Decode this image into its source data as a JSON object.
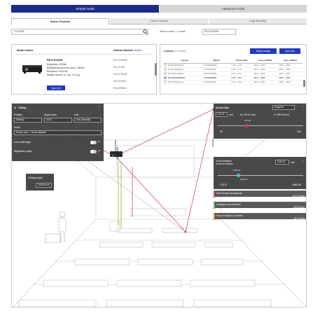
{
  "mode_tabs": {
    "simple": "Simple mode",
    "advanced": "Advanced mode"
  },
  "sub_tabs": {
    "search": "Search Projector",
    "current": "Current website",
    "edge": "Edge Blending"
  },
  "search": {
    "value": "PJ2330B",
    "result_label": "Search result : 1 model",
    "result_value": "EB-PJ2330B"
  },
  "model_panel": {
    "header": "Model Name",
    "similar_label": "Similar Models",
    "similar_select": "Select",
    "model": "EB-PJ2330B",
    "specs": [
      "Brightness: 3300lm",
      "Brightness(reduced by lens): 3300lm",
      "Resolution: WUXGA",
      "Weight: Approx. 8.7 kg / 19.2 kg"
    ],
    "spec_button": "Spec info",
    "similar_models": [
      "Pro-G7000W",
      "Pro-G7100",
      "Pro-G7200W",
      "Pro-G7400U",
      "Pro-G7500U"
    ]
  },
  "lens_panel": {
    "title": "Lenses",
    "count": "(5 model)",
    "change_button": "Media change",
    "spec_button": "Spec info",
    "columns": [
      "Lenses",
      "Model",
      "Throw ratio",
      "Lens shift(V)",
      "Lens shift(H)"
    ],
    "rows": [
      [
        "ELPLW05(Wide)",
        "V12H004W05",
        "1.04 - 1.26",
        "-60% ~ 60%",
        "-18% ~ 18%"
      ],
      [
        "ELPLU03(Wide)",
        "V12H004U03",
        "0.65 - 0.78",
        "-60% ~ 60%",
        "-18% ~ 18%"
      ],
      [
        "ELPLW04(Wide)",
        "V12H004W04",
        "1.01 - 1.51",
        "-60% ~ 60%",
        "-18% ~ 18%"
      ],
      [
        "ELPLM08(Middle)",
        "V12H004M08",
        "1.54 - 2.41",
        "-60% ~ 60%",
        "-18% ~ 18%"
      ],
      [
        "ELPLL08(Long)",
        "V12H004L08",
        "3.33 - 5.40",
        "-60% ~ 60%",
        "-18% ~ 18%"
      ]
    ],
    "selected_row": 3
  },
  "settings_panel": {
    "title": "Ceiling",
    "labels": [
      "Position",
      "Aspect ratio",
      "Unit"
    ],
    "values": [
      "Desktop",
      "16:10",
      "Inch (decimal)"
    ],
    "mode_label": "Mode",
    "mode_value": "Screen size -> Throw distance",
    "lens_shift_label": "Lens shift range",
    "lens_shift_state": "on",
    "brightness_label": "Brightness guide",
    "brightness_state": "off"
  },
  "ceiling_panel": {
    "label": "Ceiling height",
    "value": "196.85 inch"
  },
  "screen_panel": {
    "title": "Screen Size",
    "diagonal_select": "Diagonal",
    "size_value": "141.41",
    "unit": "inch",
    "w_label": "W: 119.91 inch",
    "h_label": "H: 199.35 inch",
    "slider_top": "137.81",
    "range_min": "60",
    "range_max": "300"
  },
  "distance_panel": {
    "title": "Throw distance",
    "subtitle": "(Lens to screen)",
    "value": "1132.41",
    "unit": "inch",
    "mark1": "1137.47",
    "mark2": "1178.71",
    "range_min": "175.37",
    "range_max": "4560.55"
  },
  "info_rows": [
    {
      "label": "Floor to face of projector",
      "value": "122.03 inch"
    },
    {
      "label": "Ceiling to top of screen",
      "value": "-43.83 inch"
    },
    {
      "label": "Floor to bottom of screen",
      "value": "78.75 inch"
    }
  ],
  "colors": {
    "brand": "#1c2c8c",
    "button": "#1f3ac8",
    "accent": "#e0307c"
  }
}
